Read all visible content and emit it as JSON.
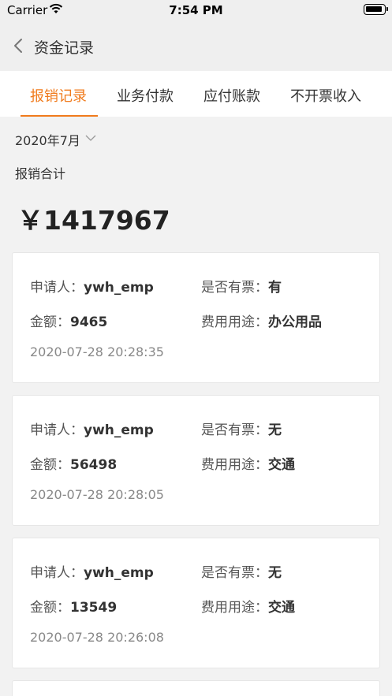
{
  "status": {
    "carrier": "Carrier",
    "time": "7:54 PM"
  },
  "nav": {
    "title": "资金记录"
  },
  "tabs": [
    "报销记录",
    "业务付款",
    "应付账款",
    "不开票收入"
  ],
  "filter": {
    "month": "2020年7月"
  },
  "summary": {
    "label": "报销合计",
    "total": "￥1417967"
  },
  "labels": {
    "applicant": "申请人：",
    "amount": "金额：",
    "has_invoice": "是否有票：",
    "usage": "费用用途："
  },
  "records": [
    {
      "applicant": "ywh_emp",
      "amount": "9465",
      "has_invoice": "有",
      "usage": "办公用品",
      "time": "2020-07-28 20:28:35"
    },
    {
      "applicant": "ywh_emp",
      "amount": "56498",
      "has_invoice": "无",
      "usage": "交通",
      "time": "2020-07-28 20:28:05"
    },
    {
      "applicant": "ywh_emp",
      "amount": "13549",
      "has_invoice": "无",
      "usage": "交通",
      "time": "2020-07-28 20:26:08"
    }
  ],
  "colors": {
    "accent": "#f07b1d",
    "background": "#f2f2f2"
  }
}
